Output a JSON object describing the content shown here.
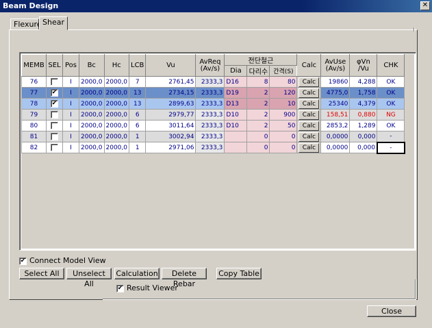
{
  "window": {
    "title": "Beam Design",
    "close_glyph": "✕"
  },
  "tabs": [
    {
      "label": "Flexure"
    },
    {
      "label": "Shear"
    }
  ],
  "grid": {
    "headers": {
      "memb": "MEMB",
      "sel": "SEL",
      "pos": "Pos",
      "bc": "Bc",
      "hc": "Hc",
      "lcb": "LCB",
      "vu": "Vu",
      "avreq": "AvReq (Av/s)",
      "rebar_group": "전단철근",
      "dia": "Dia",
      "legs": "다리수",
      "spacing": "간격(S)",
      "calc": "Calc",
      "avuse": "AvUse (Av/s)",
      "phivn": "φVn /Vu",
      "chk": "CHK"
    },
    "rows": [
      {
        "memb": "76",
        "sel": false,
        "pos": "I",
        "bc": "2000,0",
        "hc": "2000,0",
        "lcb": "7",
        "vu": "2761,45",
        "avreq": "2333,3",
        "dia": "D16",
        "legs": "8",
        "spacing": "80",
        "calc": "Calc",
        "avuse": "19860",
        "phivn": "4,288",
        "chk": "OK",
        "style": "white"
      },
      {
        "memb": "77",
        "sel": true,
        "pos": "I",
        "bc": "2000,0",
        "hc": "2000,0",
        "lcb": "13",
        "vu": "2734,15",
        "avreq": "2333,3",
        "dia": "D19",
        "legs": "2",
        "spacing": "120",
        "calc": "Calc",
        "avuse": "4775,0",
        "phivn": "1,758",
        "chk": "OK",
        "style": "selected-dark"
      },
      {
        "memb": "78",
        "sel": true,
        "pos": "I",
        "bc": "2000,0",
        "hc": "2000,0",
        "lcb": "13",
        "vu": "2899,63",
        "avreq": "2333,3",
        "dia": "D13",
        "legs": "2",
        "spacing": "10",
        "calc": "Calc",
        "avuse": "25340",
        "phivn": "4,379",
        "chk": "OK",
        "style": "selected-light"
      },
      {
        "memb": "79",
        "sel": false,
        "pos": "I",
        "bc": "2000,0",
        "hc": "2000,0",
        "lcb": "6",
        "vu": "2979,77",
        "avreq": "2333,3",
        "dia": "D10",
        "legs": "2",
        "spacing": "900",
        "calc": "Calc",
        "avuse": "158,51",
        "phivn": "0,880",
        "chk": "NG",
        "style": "gray-ng"
      },
      {
        "memb": "80",
        "sel": false,
        "pos": "I",
        "bc": "2000,0",
        "hc": "2000,0",
        "lcb": "6",
        "vu": "3011,64",
        "avreq": "2333,3",
        "dia": "D10",
        "legs": "2",
        "spacing": "50",
        "calc": "Calc",
        "avuse": "2853,2",
        "phivn": "1,289",
        "chk": "OK",
        "style": "white"
      },
      {
        "memb": "81",
        "sel": false,
        "pos": "I",
        "bc": "2000,0",
        "hc": "2000,0",
        "lcb": "1",
        "vu": "3002,94",
        "avreq": "2333,3",
        "dia": "",
        "legs": "0",
        "spacing": "0",
        "calc": "Calc",
        "avuse": "0,0000",
        "phivn": "0,000",
        "chk": "-",
        "style": "gray"
      },
      {
        "memb": "82",
        "sel": false,
        "pos": "I",
        "bc": "2000,0",
        "hc": "2000,0",
        "lcb": "1",
        "vu": "2971,06",
        "avreq": "2333,3",
        "dia": "",
        "legs": "0",
        "spacing": "0",
        "calc": "Calc",
        "avuse": "0,0000",
        "phivn": "0,000",
        "chk": "-",
        "style": "white-focus"
      }
    ]
  },
  "options": {
    "connect_model_view": "Connect Model View",
    "connect_checked": true,
    "result_viewer": "Result Viewer",
    "result_checked": true
  },
  "buttons": {
    "select_all": "Select All",
    "unselect_all": "Unselect All",
    "calculation": "Calculation",
    "delete_rebar": "Delete Rebar",
    "copy_table": "Copy Table",
    "close": "Close"
  },
  "colors": {
    "selected_dark": "#6b8fc8",
    "selected_light": "#a9c6ef",
    "gray_row": "#dcdcdc",
    "pink_cell": "#f2d5d9",
    "pink_dark": "#d9a3b0",
    "ng_red": "#e00000",
    "text_blue": "#00008b"
  }
}
